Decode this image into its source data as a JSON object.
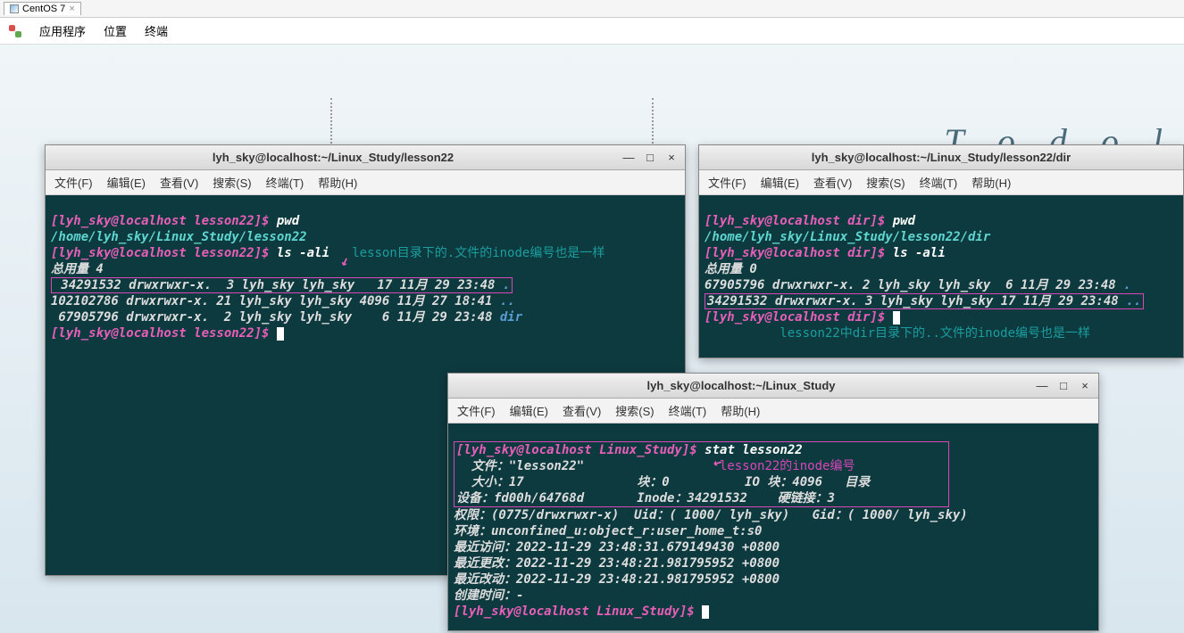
{
  "vm_tab": {
    "name": "CentOS 7",
    "close": "×"
  },
  "topmenu": {
    "apps": "应用程序",
    "places": "位置",
    "terminal": "终端"
  },
  "desktop": {
    "todo": "T o   d o   l"
  },
  "term_menus": {
    "file": "文件(F)",
    "edit": "编辑(E)",
    "view": "查看(V)",
    "search": "搜索(S)",
    "terminal": "终端(T)",
    "help": "帮助(H)"
  },
  "win_btns": {
    "min": "—",
    "max": "□",
    "close": "×"
  },
  "term1": {
    "title": "lyh_sky@localhost:~/Linux_Study/lesson22",
    "l1p": "[lyh_sky@localhost lesson22]$ ",
    "l1c": "pwd",
    "l2": "/home/lyh_sky/Linux_Study/lesson22",
    "l3p": "[lyh_sky@localhost lesson22]$ ",
    "l3c": "ls -ali",
    "anno1": "lesson目录下的.文件的inode编号也是一样",
    "l4": "总用量 4",
    "l5": " 34291532 drwxrwxr-x.  3 lyh_sky lyh_sky   17 11月 29 23:48 ",
    "l5d": ".",
    "l6": "102102786 drwxrwxr-x. 21 lyh_sky lyh_sky 4096 11月 27 18:41 ",
    "l6d": "..",
    "l7": " 67905796 drwxrwxr-x.  2 lyh_sky lyh_sky    6 11月 29 23:48 ",
    "l7d": "dir",
    "l8p": "[lyh_sky@localhost lesson22]$ "
  },
  "term2": {
    "title": "lyh_sky@localhost:~/Linux_Study/lesson22/dir",
    "l1p": "[lyh_sky@localhost dir]$ ",
    "l1c": "pwd",
    "l2": "/home/lyh_sky/Linux_Study/lesson22/dir",
    "l3p": "[lyh_sky@localhost dir]$ ",
    "l3c": "ls -ali",
    "l4": "总用量 0",
    "l5": "67905796 drwxrwxr-x. 2 lyh_sky lyh_sky  6 11月 29 23:48 ",
    "l5d": ".",
    "l6": "34291532 drwxrwxr-x. 3 lyh_sky lyh_sky 17 11月 29 23:48 ",
    "l6d": "..",
    "l7p": "[lyh_sky@localhost dir]$ ",
    "anno": "lesson22中dir目录下的..文件的inode编号也是一样"
  },
  "term3": {
    "title": "lyh_sky@localhost:~/Linux_Study",
    "l1p": "[lyh_sky@localhost Linux_Study]$ ",
    "l1c": "stat lesson22",
    "anno": "lesson22的inode编号",
    "l2": "  文件：\"lesson22\"",
    "l3": "  大小：17        \t块：0          IO 块：4096   目录",
    "l4": "设备：fd00h/64768d\tInode：34291532    硬链接：3",
    "l5": "权限：(0775/drwxrwxr-x)  Uid：( 1000/ lyh_sky)   Gid：( 1000/ lyh_sky)",
    "l6": "环境：unconfined_u:object_r:user_home_t:s0",
    "l7": "最近访问：2022-11-29 23:48:31.679149430 +0800",
    "l8": "最近更改：2022-11-29 23:48:21.981795952 +0800",
    "l9": "最近改动：2022-11-29 23:48:21.981795952 +0800",
    "l10": "创建时间：-",
    "l11p": "[lyh_sky@localhost Linux_Study]$ "
  }
}
